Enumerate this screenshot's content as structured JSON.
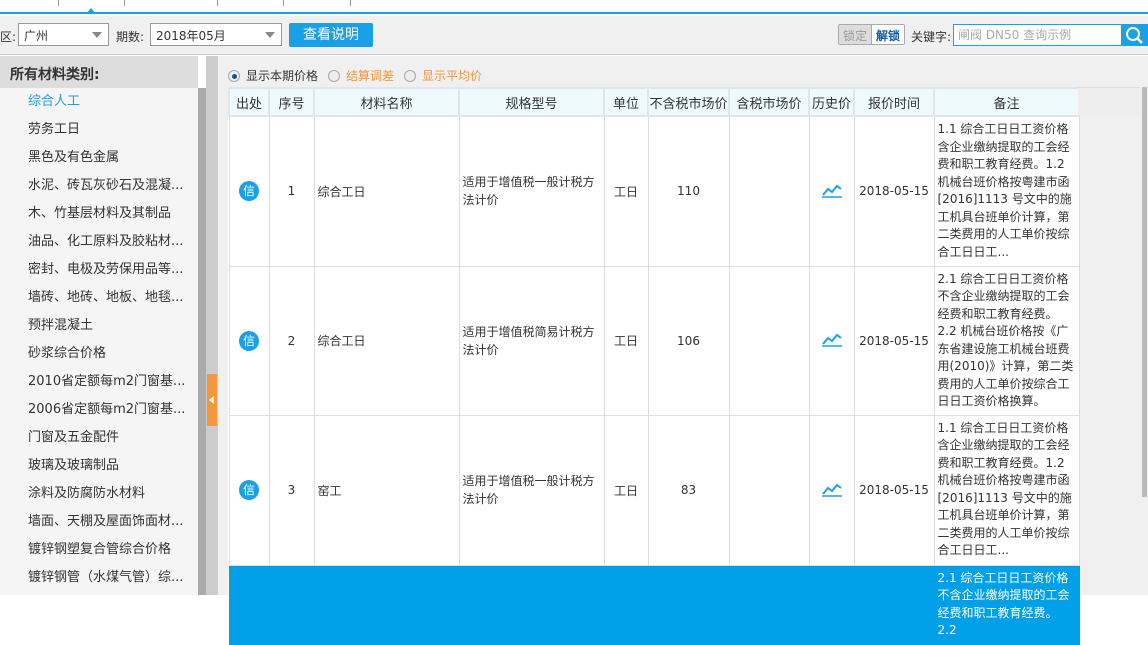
{
  "toolbar": {
    "region_label": "区:",
    "region_value": "广州",
    "period_label": "期数:",
    "period_value": "2018年05月",
    "help_button": "查看说明",
    "lock_button": "锁定",
    "unlock_button": "解锁",
    "keyword_label": "关键字:",
    "search_placeholder": "闸阀 DN50 查询示例"
  },
  "sidebar": {
    "title": "所有材料类别:",
    "items": [
      "综合人工",
      "劳务工日",
      "黑色及有色金属",
      "水泥、砖瓦灰砂石及混凝...",
      "木、竹基层材料及其制品",
      "油品、化工原料及胶粘材...",
      "密封、电极及劳保用品等...",
      "墙砖、地砖、地板、地毯...",
      "预拌混凝土",
      "砂浆综合价格",
      "2010省定额每m2门窗基...",
      "2006省定额每m2门窗基...",
      "门窗及五金配件",
      "玻璃及玻璃制品",
      "涂料及防腐防水材料",
      "墙面、天棚及屋面饰面材...",
      "镀锌钢塑复合管综合价格",
      "镀锌钢管（水煤气管）综..."
    ]
  },
  "radios": [
    "显示本期价格",
    "结算调差",
    "显示平均价"
  ],
  "table": {
    "headers": [
      "出处",
      "序号",
      "材料名称",
      "规格型号",
      "单位",
      "不含税市场价",
      "含税市场价",
      "历史价",
      "报价时间",
      "备注"
    ],
    "rows": [
      {
        "src": "信",
        "no": "1",
        "name": "综合工日",
        "spec": "适用于增值税一般计税方法计价",
        "unit": "工日",
        "price": "110",
        "price_tax": "",
        "date": "2018-05-15",
        "note": "1.1 综合工日日工资价格含企业缴纳提取的工会经费和职工教育经费。1.2 机械台班价格按粤建市函[2016]1113 号文中的施工机具台班单价计算，第二类费用的人工单价按综合工日日工..."
      },
      {
        "src": "信",
        "no": "2",
        "name": "综合工日",
        "spec": "适用于增值税简易计税方法计价",
        "unit": "工日",
        "price": "106",
        "price_tax": "",
        "date": "2018-05-15",
        "note": "2.1 综合工日日工资价格不含企业缴纳提取的工会经费和职工教育经费。2.2 机械台班价格按《广东省建设施工机械台班费用(2010)》计算，第二类费用的人工单价按综合工日日工资价格换算。"
      },
      {
        "src": "信",
        "no": "3",
        "name": "窑工",
        "spec": "适用于增值税一般计税方法计价",
        "unit": "工日",
        "price": "83",
        "price_tax": "",
        "date": "2018-05-15",
        "note": "1.1 综合工日日工资价格含企业缴纳提取的工会经费和职工教育经费。1.2 机械台班价格按粤建市函[2016]1113 号文中的施工机具台班单价计算，第二类费用的人工单价按综合工日日工..."
      },
      {
        "src": "",
        "no": "",
        "name": "",
        "spec": "",
        "unit": "",
        "price": "",
        "price_tax": "",
        "date": "",
        "note": "2.1 综合工日日工资价格不含企业缴纳提取的工会经费和职工教育经费。2.2"
      }
    ]
  },
  "colors": {
    "accent": "#1aa0e6",
    "orange": "#f7953a",
    "selected_row": "#00a0e9"
  }
}
